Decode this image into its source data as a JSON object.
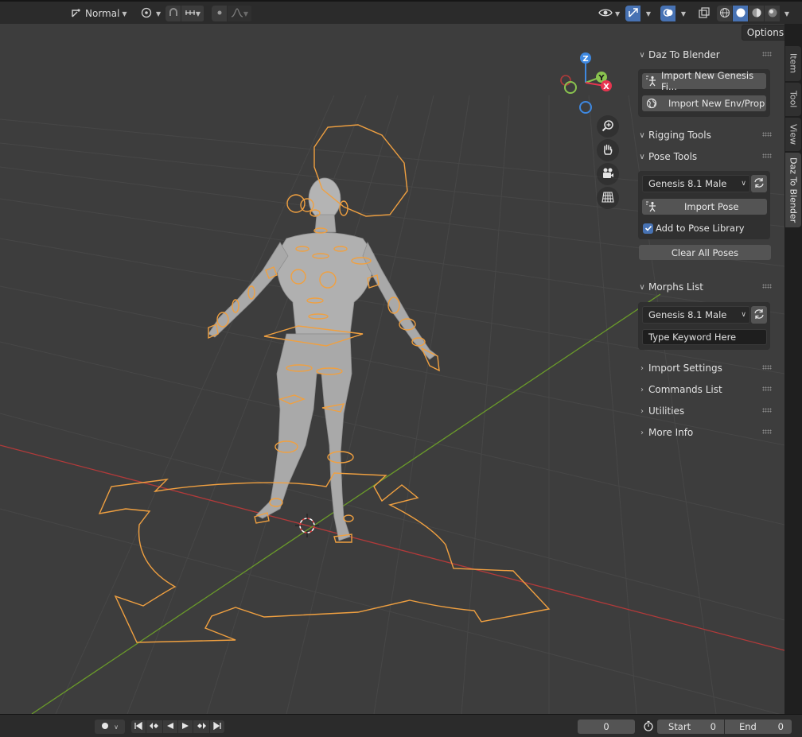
{
  "header": {
    "mode_label": "Normal",
    "mode_icon": "transform-orientation-icon",
    "pivot_icon": "pivot-icon",
    "snap_icon": "snap-magnet-icon",
    "snap_target_icon": "snap-increment-icon",
    "proportional_icon": "proportional-edit-icon",
    "falloff_icon": "falloff-curve-icon",
    "visibility_icon": "eye-icon",
    "gizmo_icon": "gizmo-icon",
    "overlay_icon": "overlays-icon",
    "xray_icon": "xray-icon",
    "shading_modes": [
      "wireframe",
      "solid",
      "material",
      "rendered"
    ],
    "active_shading": "solid",
    "options_label": "Options"
  },
  "nav_gizmo": {
    "z_label": "Z",
    "y_label": "Y",
    "x_label": "X",
    "colors": {
      "x": "#e8354f",
      "y": "#8ac44f",
      "z": "#3e88e0"
    }
  },
  "nav_tools": [
    "zoom-icon",
    "hand-pan-icon",
    "camera-icon",
    "grid-ortho-icon"
  ],
  "panels": {
    "daz_to_blender": {
      "title": "Daz To Blender",
      "import_genesis_label": "Import New Genesis Fi...",
      "import_env_label": "Import New Env/Prop"
    },
    "rigging_tools": {
      "title": "Rigging Tools"
    },
    "pose_tools": {
      "title": "Pose Tools",
      "figure_select": "Genesis 8.1 Male",
      "import_pose_label": "Import Pose",
      "add_to_library_label": "Add to Pose Library",
      "add_to_library_checked": true,
      "clear_poses_label": "Clear All Poses"
    },
    "morphs_list": {
      "title": "Morphs List",
      "figure_select": "Genesis 8.1 Male",
      "keyword_placeholder": "Type Keyword Here"
    },
    "import_settings": {
      "title": "Import Settings"
    },
    "commands_list": {
      "title": "Commands List"
    },
    "utilities": {
      "title": "Utilities"
    },
    "more_info": {
      "title": "More Info"
    }
  },
  "side_tabs": [
    "Item",
    "Tool",
    "View",
    "Daz To Blender"
  ],
  "active_side_tab": "Daz To Blender",
  "timeline": {
    "current_frame": "0",
    "start_label": "Start",
    "start_value": "0",
    "end_label": "End",
    "end_value": "0"
  },
  "colors": {
    "accent": "#4772b3",
    "rig_outline": "#f0a040",
    "x_axis": "#c33a3a",
    "y_axis": "#6a9a2a",
    "viewport_bg": "#3d3d3d"
  }
}
